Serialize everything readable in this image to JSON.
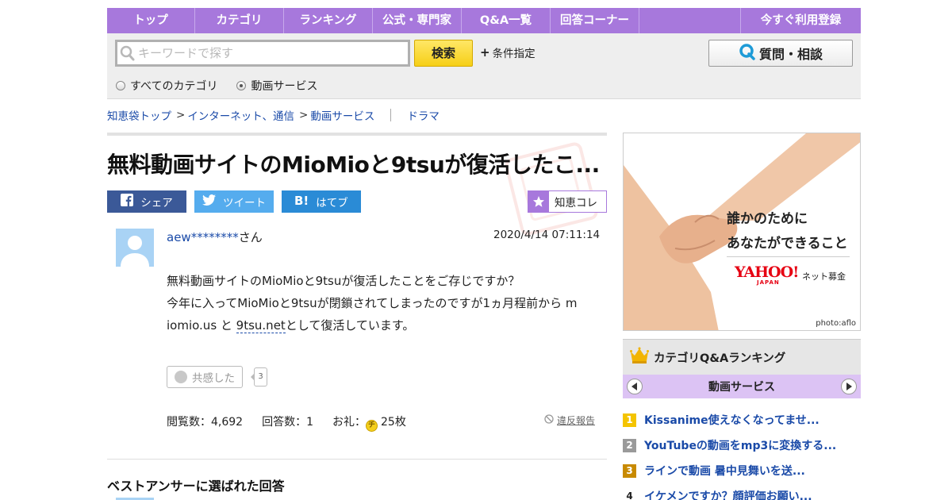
{
  "nav": {
    "items": [
      "トップ",
      "カテゴリ",
      "ランキング",
      "公式・専門家",
      "Q&A一覧",
      "回答コーナー"
    ],
    "register": "今すぐ利用登録"
  },
  "search": {
    "placeholder": "キーワードで探す",
    "button": "検索",
    "conditions": "条件指定",
    "ask_button": "質問・相談",
    "radio_all": "すべてのカテゴリ",
    "radio_current": "動画サービス"
  },
  "breadcrumb": {
    "items": [
      "知恵袋トップ",
      "インターネット、通信",
      "動画サービス"
    ],
    "sep": ">",
    "tag": "ドラマ"
  },
  "question": {
    "title": "無料動画サイトのMioMioと9tsuが復活したこ...",
    "share_fb": "シェア",
    "share_tw": "ツイート",
    "share_hb": "はてブ",
    "collect": "知恵コレ",
    "user": "aew********",
    "user_suffix": "さん",
    "date": "2020/4/14  07:11:14",
    "body_line1": "無料動画サイトのMioMioと9tsuが復活したことをご存じですか？",
    "body_line2": "今年に入ってMioMioと9tsuが閉鎖されてしまったのですが1ヵ月程前から m",
    "body_line3a": "iomio.us と ",
    "body_link": "9tsu.net",
    "body_line3b": "として復活しています。",
    "empathy": "共感した",
    "empathy_count": "3",
    "views": "閲覧数：4,692",
    "answers": "回答数：1",
    "reward_label": "お礼：",
    "reward_coin": "チ",
    "reward": "25枚",
    "report": "違反報告"
  },
  "best": {
    "title": "ベストアンサーに選ばれた回答"
  },
  "ad": {
    "copy1": "誰かのために",
    "copy2": "あなたができること",
    "logo": "YAHOO!",
    "logo_sub": "JAPAN",
    "sub": "ネット募金",
    "credit": "photo:aflo"
  },
  "ranking": {
    "title": "カテゴリQ&Aランキング",
    "category": "動画サービス",
    "items": [
      {
        "num": "1",
        "text": "Kissanime使えなくなってませ...",
        "color": "#f4c400"
      },
      {
        "num": "2",
        "text": "YouTubeの動画をmp3に変換する...",
        "color": "#9a9a9a"
      },
      {
        "num": "3",
        "text": "ラインで動画 暑中見舞いを送...",
        "color": "#c88a00"
      },
      {
        "num": "4",
        "text": "イケメンですか？顔評価お願い...",
        "color": "#ffffff"
      }
    ]
  },
  "colors": {
    "nav": "#a778dc",
    "link": "#1a4aa8",
    "accent_yellow": "#f6cf17"
  }
}
